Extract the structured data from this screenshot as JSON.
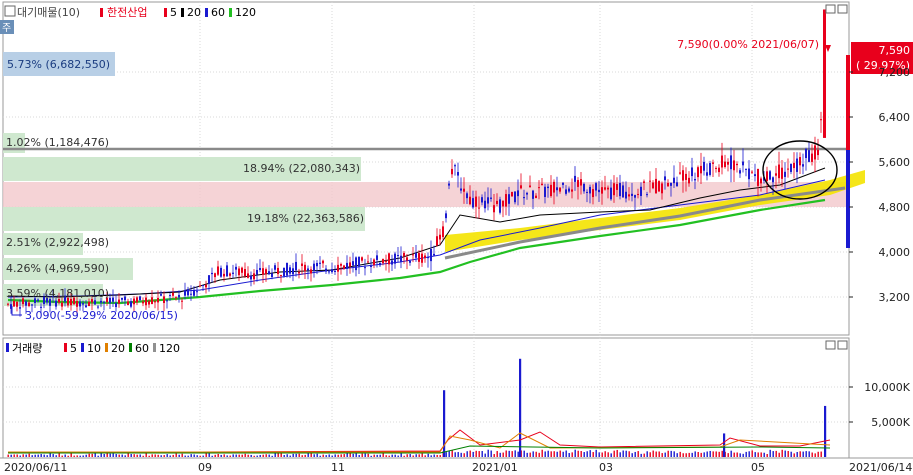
{
  "price_panel": {
    "legend": {
      "prefix": "대기매물(10)",
      "stock": "한전산업",
      "ma_items": [
        {
          "label": "5",
          "color": "#e8001c"
        },
        {
          "label": "20",
          "color": "#000000"
        },
        {
          "label": "60",
          "color": "#1a1ad0"
        },
        {
          "label": "120",
          "color": "#22c022"
        }
      ]
    },
    "y_ticks": [
      "7,200",
      "6,400",
      "5,600",
      "4,800",
      "4,000",
      "3,200"
    ],
    "current_price": "7,590",
    "current_change": "( 29.97%)",
    "high_annotation": "7,590(0.00% 2021/06/07)",
    "low_annotation": "3,090(-59.29% 2020/06/15)",
    "volume_profile": [
      "5.73% (6,682,550)",
      "1.02% (1,184,476)",
      "18.94% (22,080,343)",
      "19.18% (22,363,586)",
      "2.51% (2,922,498)",
      "4.26% (4,969,590)",
      "3.59% (4,181,010)"
    ],
    "side_label": "주"
  },
  "volume_panel": {
    "legend": {
      "title": "거래량",
      "ma_items": [
        {
          "label": "5",
          "color": "#e8001c"
        },
        {
          "label": "10",
          "color": "#1a1ad0"
        },
        {
          "label": "20",
          "color": "#e08000"
        },
        {
          "label": "60",
          "color": "#008000"
        },
        {
          "label": "120",
          "color": "#909090"
        }
      ]
    },
    "y_ticks": [
      "10,000K",
      "5,000K"
    ]
  },
  "x_axis": {
    "labels": [
      "2020/06/11",
      "09",
      "11",
      "2021/01",
      "03",
      "05",
      "2021/06/14"
    ]
  },
  "chart_data": {
    "type": "candlestick",
    "title": "한전산업",
    "x_range": [
      "2020/06/11",
      "2021/06/14"
    ],
    "price_ylim": [
      2800,
      7700
    ],
    "volume_ylim_k": [
      0,
      14000
    ],
    "moving_averages": [
      "5",
      "20",
      "60",
      "120"
    ],
    "price_series": [
      {
        "date": "2020/06",
        "close": 3300
      },
      {
        "date": "2020/07",
        "close": 3350
      },
      {
        "date": "2020/08",
        "close": 3400
      },
      {
        "date": "2020/09",
        "close": 3700
      },
      {
        "date": "2020/10",
        "close": 3800
      },
      {
        "date": "2020/11",
        "close": 3900
      },
      {
        "date": "2020/12",
        "close": 4900
      },
      {
        "date": "2021/01",
        "close": 4800
      },
      {
        "date": "2021/02",
        "close": 4900
      },
      {
        "date": "2021/03",
        "close": 5000
      },
      {
        "date": "2021/04",
        "close": 5200
      },
      {
        "date": "2021/05",
        "close": 5300
      },
      {
        "date": "2021/06/07",
        "close": 7590
      }
    ],
    "volume_spikes_k": [
      {
        "date": "2020/12",
        "value": 8500
      },
      {
        "date": "2021/01",
        "value": 12500
      },
      {
        "date": "2021/04",
        "value": 3000
      },
      {
        "date": "2021/06/07",
        "value": 6500
      }
    ]
  }
}
